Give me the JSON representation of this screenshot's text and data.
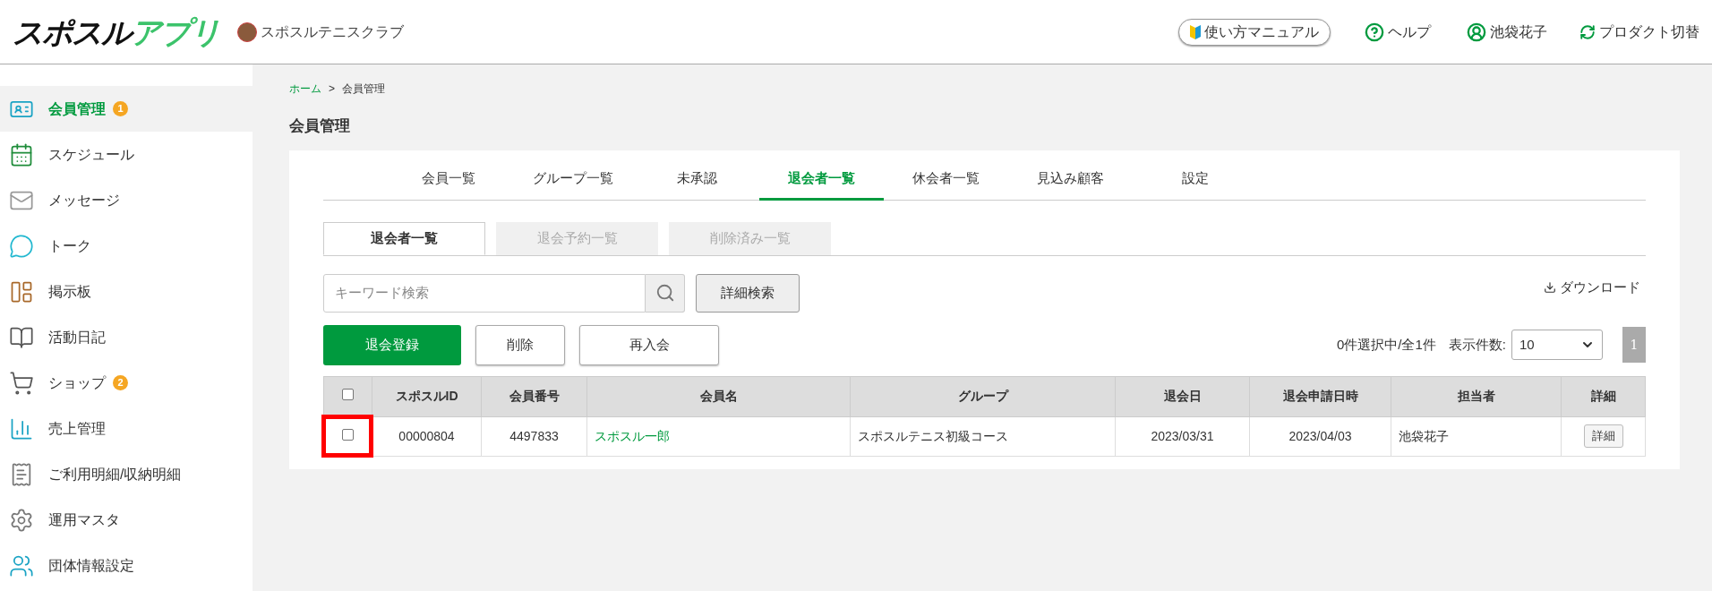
{
  "header": {
    "logo": {
      "main": "スポスル",
      "accent": "アプリ"
    },
    "club_name": "スポスルテニスクラブ",
    "manual_button": "使い方マニュアル",
    "help": "ヘルプ",
    "user": "池袋花子",
    "switch_product": "プロダクト切替"
  },
  "sidebar": {
    "items": [
      {
        "label": "会員管理",
        "selected": true,
        "badge": "1"
      },
      {
        "label": "スケジュール",
        "selected": false
      },
      {
        "label": "メッセージ",
        "selected": false
      },
      {
        "label": "トーク",
        "selected": false
      },
      {
        "label": "掲示板",
        "selected": false
      },
      {
        "label": "活動日記",
        "selected": false
      },
      {
        "label": "ショップ",
        "selected": false,
        "badge": "2"
      },
      {
        "label": "売上管理",
        "selected": false
      },
      {
        "label": "ご利用明細/収納明細",
        "selected": false
      },
      {
        "label": "運用マスタ",
        "selected": false
      },
      {
        "label": "団体情報設定",
        "selected": false
      }
    ]
  },
  "breadcrumb": [
    {
      "label": "ホーム",
      "kind": "link"
    },
    {
      "label": ">",
      "kind": "separator"
    },
    {
      "label": "会員管理",
      "kind": "current"
    }
  ],
  "page_title": "会員管理",
  "tabs": [
    {
      "label": "会員一覧",
      "selected": false
    },
    {
      "label": "グループ一覧",
      "selected": false
    },
    {
      "label": "未承認",
      "selected": false
    },
    {
      "label": "退会者一覧",
      "selected": true
    },
    {
      "label": "休会者一覧",
      "selected": false
    },
    {
      "label": "見込み顧客",
      "selected": false
    },
    {
      "label": "設定",
      "selected": false
    }
  ],
  "subtabs": [
    {
      "label": "退会者一覧",
      "selected": true
    },
    {
      "label": "退会予約一覧",
      "selected": false
    },
    {
      "label": "削除済み一覧",
      "selected": false
    }
  ],
  "search": {
    "placeholder": "キーワード検索",
    "advanced_button": "詳細検索"
  },
  "download": "ダウンロード",
  "actions": [
    {
      "label": "退会登録",
      "kind": "primary"
    },
    {
      "label": "削除",
      "kind": "secondary"
    },
    {
      "label": "再入会",
      "kind": "secondary"
    }
  ],
  "selection_summary": "0件選択中/全1件",
  "page_size": {
    "label": "表示件数:",
    "value": "10"
  },
  "pagination": [
    {
      "label": "1",
      "selected": true
    }
  ],
  "table": {
    "header_checked": false,
    "columns": [
      {
        "label": "スポスルID"
      },
      {
        "label": "会員番号"
      },
      {
        "label": "会員名"
      },
      {
        "label": "グループ"
      },
      {
        "label": "退会日"
      },
      {
        "label": "退会申請日時"
      },
      {
        "label": "担当者"
      },
      {
        "label": "詳細"
      }
    ],
    "rows": [
      {
        "checked": false,
        "highlighted": true,
        "cells": [
          {
            "text": "00000804",
            "kind": "text"
          },
          {
            "text": "4497833",
            "kind": "text"
          },
          {
            "text": "スポスル一郎",
            "kind": "link"
          },
          {
            "text": "スポスルテニス初級コース",
            "kind": "text"
          },
          {
            "text": "2023/03/31",
            "kind": "text"
          },
          {
            "text": "2023/04/03",
            "kind": "text"
          },
          {
            "text": "池袋花子",
            "kind": "text"
          },
          {
            "text": "詳細",
            "kind": "button"
          }
        ]
      }
    ]
  }
}
